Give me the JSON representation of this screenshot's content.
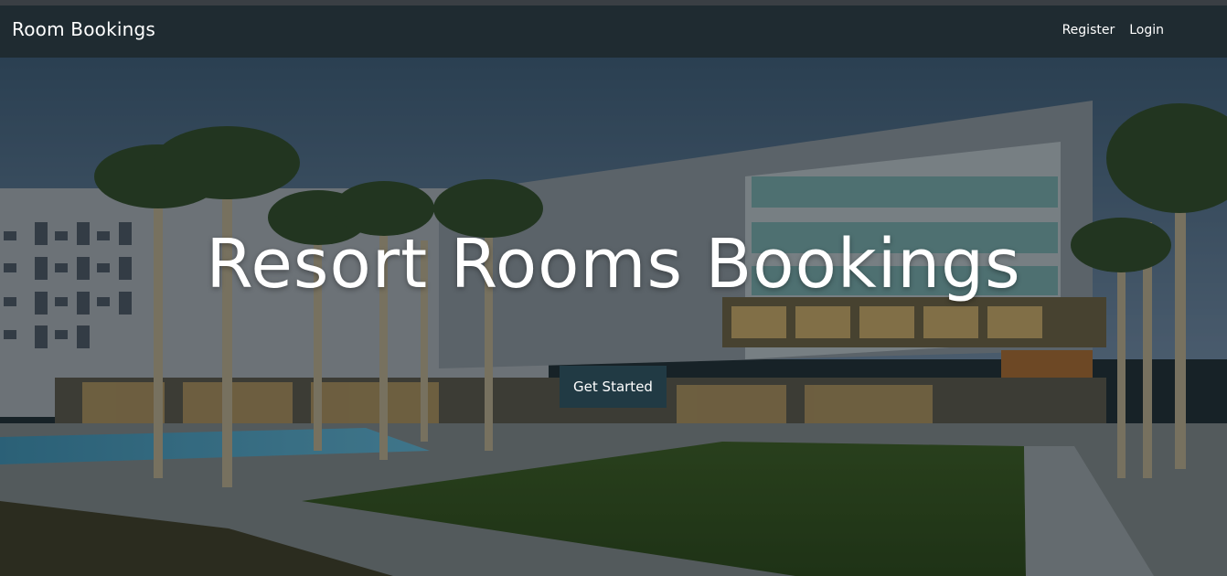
{
  "navbar": {
    "brand": "Room Bookings",
    "links": [
      {
        "label": "Register"
      },
      {
        "label": "Login"
      }
    ]
  },
  "hero": {
    "title": "Resort Rooms Bookings",
    "cta_label": "Get Started",
    "background_image": "resort hotel building with palm trees, pool and lawn at dusk"
  },
  "colors": {
    "navbar_bg": "#1f2b31",
    "button_bg": "#213a44",
    "text": "#ffffff"
  }
}
